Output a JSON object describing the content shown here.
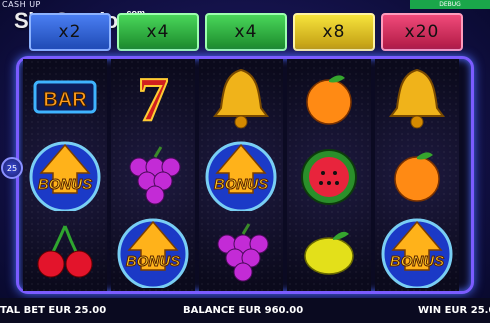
{
  "title": "CASH UP",
  "debug_label": "DEBUG",
  "logo": {
    "main": "SlotCatalog",
    "suffix": ".com"
  },
  "multipliers": [
    {
      "label": "x2",
      "color": "blue"
    },
    {
      "label": "x4",
      "color": "green"
    },
    {
      "label": "x4",
      "color": "green"
    },
    {
      "label": "x8",
      "color": "yellow"
    },
    {
      "label": "x20",
      "color": "red"
    }
  ],
  "lines": "25",
  "reels": [
    [
      "bar",
      "bonus",
      "cherries"
    ],
    [
      "seven",
      "grapes",
      "bonus"
    ],
    [
      "bell",
      "bonus",
      "grapes"
    ],
    [
      "orange",
      "watermelon",
      "lemon"
    ],
    [
      "bell",
      "orange",
      "bonus"
    ]
  ],
  "symbol_labels": {
    "bar": "BAR",
    "bonus": "BONUS",
    "seven": "7"
  },
  "bottom": {
    "total_bet": "TAL BET EUR 25.00",
    "balance": "BALANCE EUR 960.00",
    "win": "WIN EUR 25.0"
  },
  "colors": {
    "frame": "#7b5cff",
    "accent_blue": "#4a7ef2",
    "accent_green": "#49d65a",
    "accent_yellow": "#f6e33c",
    "accent_red": "#f04a7a"
  }
}
